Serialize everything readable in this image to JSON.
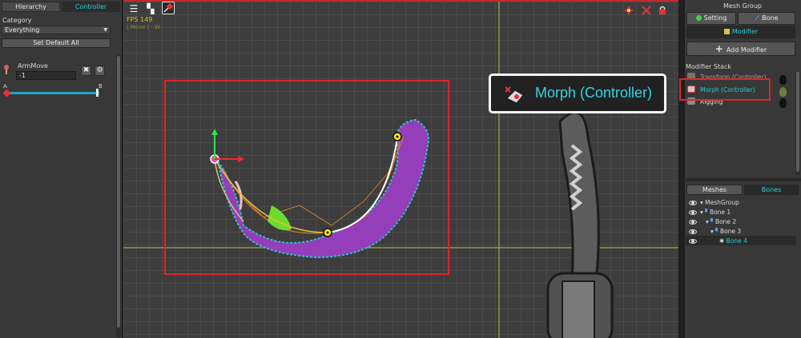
{
  "left_panel": {
    "tabs": [
      {
        "label": "Hierarchy"
      },
      {
        "label": "Controller"
      }
    ],
    "category_label": "Category",
    "category_value": "Everything",
    "set_default_all": "Set Default All",
    "param_name": "ArmMove",
    "param_value": "-1",
    "slider_min_label": "A",
    "slider_max_label": "B",
    "slider_position": 1.0
  },
  "viewport": {
    "fps_text": "FPS 149",
    "mode_text": "| Move | - W",
    "callout_title": "Morph (Controller)"
  },
  "right_panel": {
    "title": "Mesh Group",
    "setting_button": "Setting",
    "bone_button": "Bone",
    "modifier_button": "Modifier",
    "add_modifier": "Add Modifier",
    "modifier_stack_label": "Modifier Stack",
    "modifiers": [
      {
        "label": "Transform (Controller)"
      },
      {
        "label": "Morph (Controller)"
      },
      {
        "label": "Rigging"
      }
    ],
    "tree_tabs": [
      {
        "label": "Meshes"
      },
      {
        "label": "Bones"
      }
    ],
    "tree": [
      {
        "label": "MeshGroup"
      },
      {
        "label": "Bone 1"
      },
      {
        "label": "Bone 2"
      },
      {
        "label": "Bone 3"
      },
      {
        "label": "Bone 4"
      }
    ]
  },
  "colors": {
    "accent_cyan": "#23d0d8",
    "highlight_red": "#e2232a",
    "mesh_purple": "#9a3fc0",
    "mesh_cyan": "#2ec7d6",
    "bone_yellow": "#ffe21a"
  }
}
